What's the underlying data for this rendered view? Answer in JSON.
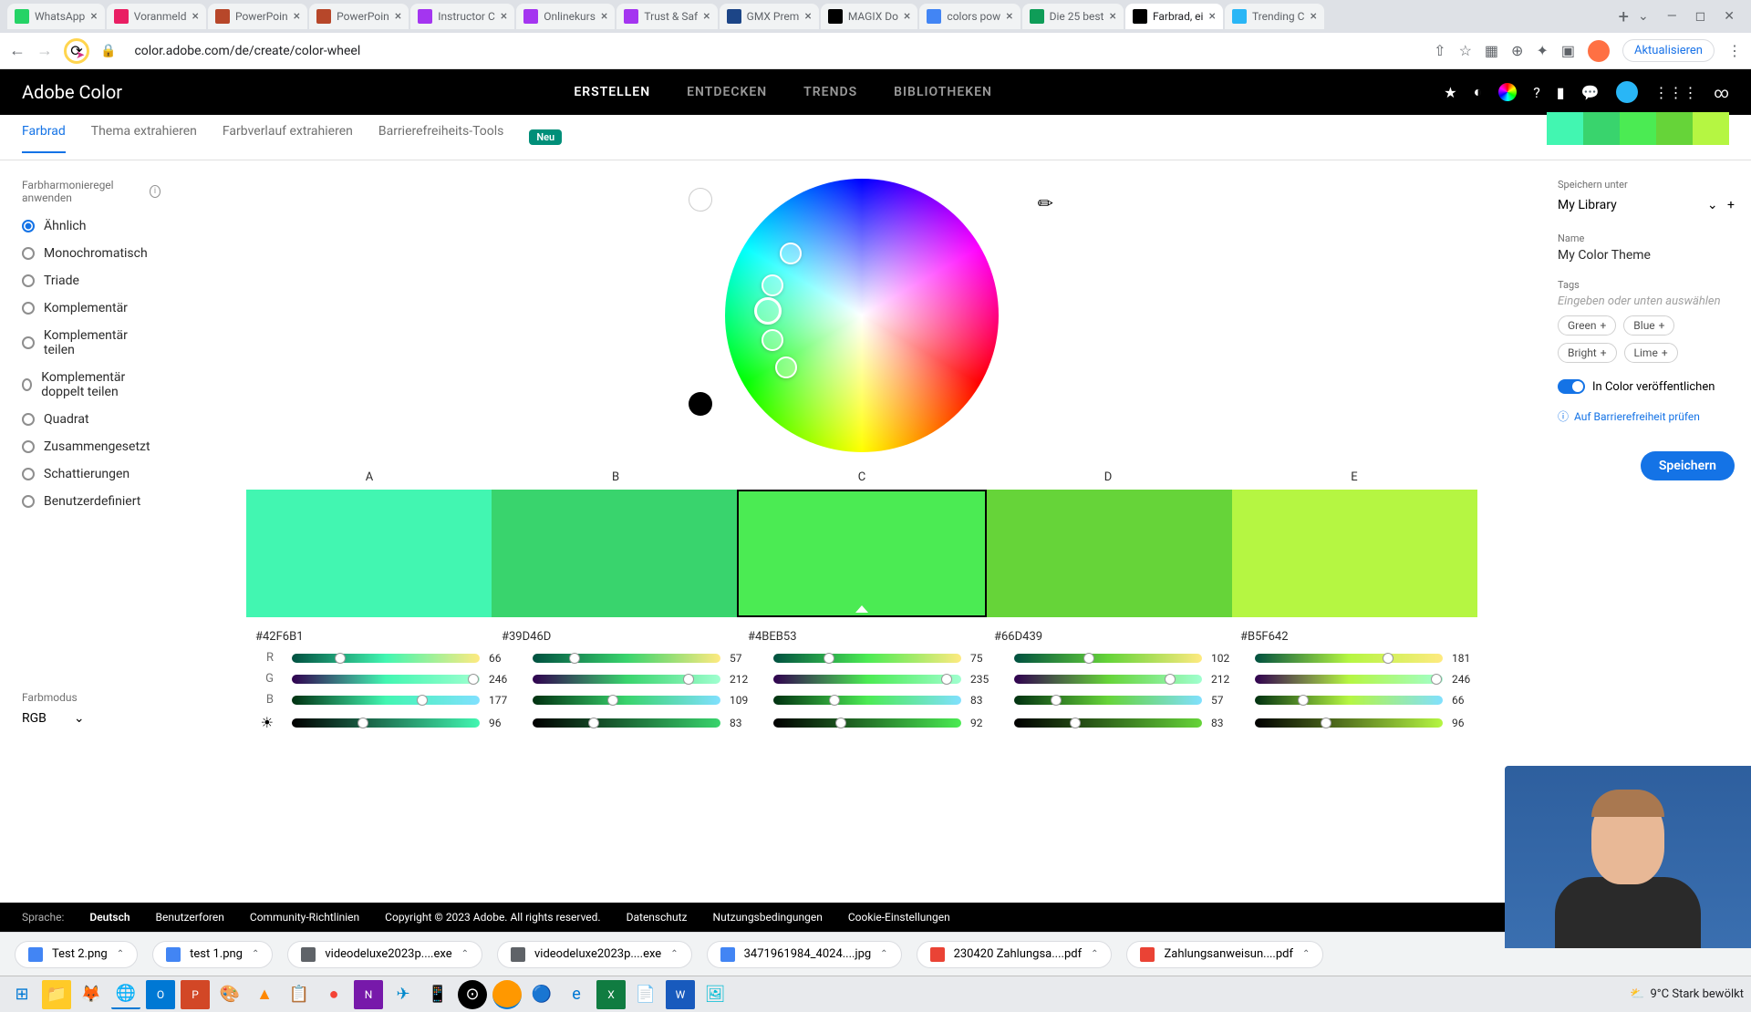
{
  "browser": {
    "tabs": [
      {
        "title": "WhatsApp",
        "color": "#25d366"
      },
      {
        "title": "Voranmeld",
        "color": "#e91e63"
      },
      {
        "title": "PowerPoin",
        "color": "#b7472a"
      },
      {
        "title": "PowerPoin",
        "color": "#b7472a"
      },
      {
        "title": "Instructor C",
        "color": "#a435f0"
      },
      {
        "title": "Onlinekurs",
        "color": "#a435f0"
      },
      {
        "title": "Trust & Saf",
        "color": "#a435f0"
      },
      {
        "title": "GMX Prem",
        "color": "#1c4587"
      },
      {
        "title": "MAGIX Do",
        "color": "#000"
      },
      {
        "title": "colors pow",
        "color": "#4285f4"
      },
      {
        "title": "Die 25 best",
        "color": "#0f9d58"
      },
      {
        "title": "Farbrad, ei",
        "color": "#000",
        "active": true
      },
      {
        "title": "Trending C",
        "color": "#29b6f6"
      }
    ],
    "url": "color.adobe.com/de/create/color-wheel",
    "refresh": "Aktualisieren"
  },
  "header": {
    "logo": "Adobe Color",
    "nav": [
      "ERSTELLEN",
      "ENTDECKEN",
      "TRENDS",
      "BIBLIOTHEKEN"
    ]
  },
  "subnav": {
    "tabs": [
      "Farbrad",
      "Thema extrahieren",
      "Farbverlauf extrahieren",
      "Barrierefreiheits-Tools"
    ],
    "neu": "Neu"
  },
  "left": {
    "ruleLabel": "Farbharmonieregel anwenden",
    "rules": [
      "Ähnlich",
      "Monochromatisch",
      "Triade",
      "Komplementär",
      "Komplementär teilen",
      "Komplementär doppelt teilen",
      "Quadrat",
      "Zusammengesetzt",
      "Schattierungen",
      "Benutzerdefiniert"
    ],
    "modeLabel": "Farbmodus",
    "mode": "RGB"
  },
  "swatches": {
    "labels": [
      "A",
      "B",
      "C",
      "D",
      "E"
    ],
    "colors": [
      "#42F6B1",
      "#39D46D",
      "#4BEB53",
      "#66D439",
      "#B5F642"
    ],
    "hex": [
      "#42F6B1",
      "#39D46D",
      "#4BEB53",
      "#66D439",
      "#B5F642"
    ],
    "rgb": [
      {
        "r": 66,
        "g": 246,
        "b": 177,
        "l": 96
      },
      {
        "r": 57,
        "g": 212,
        "b": 109,
        "l": 83
      },
      {
        "r": 75,
        "g": 235,
        "b": 83,
        "l": 92
      },
      {
        "r": 102,
        "g": 212,
        "b": 57,
        "l": 83
      },
      {
        "r": 181,
        "g": 246,
        "b": 66,
        "l": 96
      }
    ],
    "channels": [
      "R",
      "G",
      "B"
    ]
  },
  "right": {
    "saveLabel": "Speichern unter",
    "library": "My Library",
    "nameLabel": "Name",
    "themeName": "My Color Theme",
    "tagsLabel": "Tags",
    "tagsPlaceholder": "Eingeben oder unten auswählen",
    "tags": [
      "Green",
      "Blue",
      "Bright",
      "Lime"
    ],
    "publish": "In Color veröffentlichen",
    "accessibility": "Auf Barrierefreiheit prüfen",
    "save": "Speichern"
  },
  "footer": {
    "langLabel": "Sprache:",
    "lang": "Deutsch",
    "links": [
      "Benutzerforen",
      "Community-Richtlinien"
    ],
    "copyright": "Copyright © 2023 Adobe. All rights reserved.",
    "legal": [
      "Datenschutz",
      "Nutzungsbedingungen",
      "Cookie-Einstellungen"
    ]
  },
  "downloads": [
    {
      "name": "Test 2.png",
      "icon": "#4285f4"
    },
    {
      "name": "test 1.png",
      "icon": "#4285f4"
    },
    {
      "name": "videodeluxe2023p....exe",
      "icon": "#5f6368"
    },
    {
      "name": "videodeluxe2023p....exe",
      "icon": "#5f6368"
    },
    {
      "name": "3471961984_4024....jpg",
      "icon": "#4285f4"
    },
    {
      "name": "230420 Zahlungsa....pdf",
      "icon": "#ea4335"
    },
    {
      "name": "Zahlungsanweisun....pdf",
      "icon": "#ea4335"
    }
  ],
  "weather": "9°C  Stark bewölkt"
}
